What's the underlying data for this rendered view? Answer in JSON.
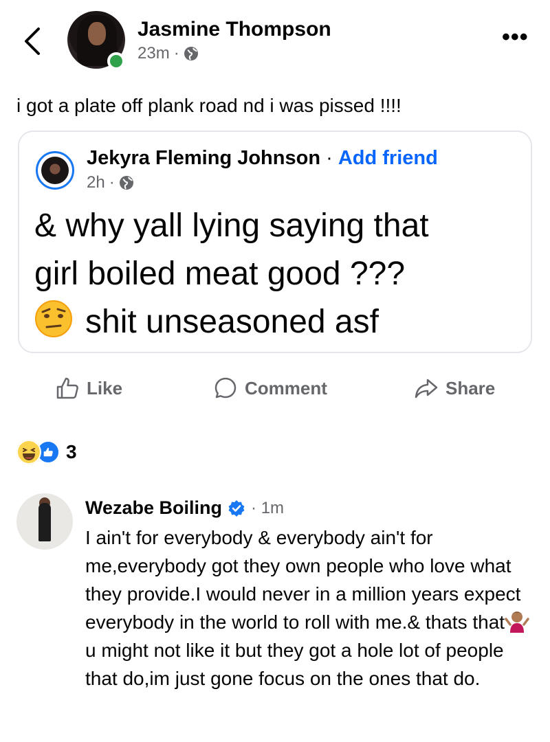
{
  "header": {
    "author": "Jasmine Thompson",
    "time": "23m",
    "separator": "·"
  },
  "post": {
    "text": "i got a plate off plank road nd i was pissed !!!!"
  },
  "shared": {
    "author": "Jekyra Fleming Johnson",
    "dot": " · ",
    "add_friend": "Add friend",
    "time": "2h",
    "separator": "·",
    "line1": "& why yall lying saying that",
    "line2": "girl boiled meat good ???",
    "line3": "shit unseasoned asf"
  },
  "actions": {
    "like": "Like",
    "comment": "Comment",
    "share": "Share"
  },
  "reactions": {
    "count": "3"
  },
  "comment": {
    "author": "Wezabe Boiling",
    "time": "· 1m",
    "text_part1": "I ain't for everybody & everybody ain't for me,everybody got they own people who love what they provide.I would never in a million years expect everybody in the world to roll with me.& thats that",
    "text_part2": "u might not like it but they got a hole lot of people that do,im just gone focus on the ones that do."
  },
  "colors": {
    "accent": "#0866ff",
    "secondary_text": "#65676b",
    "online": "#31a24c",
    "verified": "#1877f2"
  },
  "icons": {
    "back": "chevron-left-icon",
    "more": "more-dots-icon",
    "privacy": "globe-icon",
    "like": "thumbs-up-icon",
    "comment": "comment-bubble-icon",
    "share": "share-arrow-icon",
    "verified": "verified-badge-icon"
  }
}
